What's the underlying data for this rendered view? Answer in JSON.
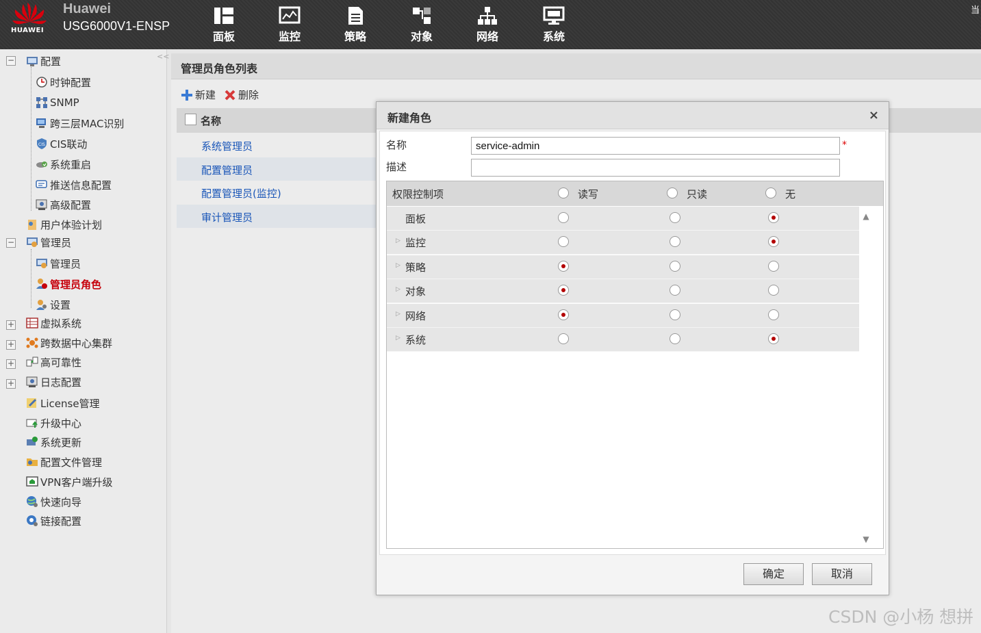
{
  "header": {
    "brand": "Huawei",
    "model": "USG6000V1-ENSP",
    "logo_text": "HUAWEI",
    "corner_glyph": "当",
    "nav": [
      {
        "label": "面板",
        "icon": "dashboard-icon"
      },
      {
        "label": "监控",
        "icon": "monitor-icon"
      },
      {
        "label": "策略",
        "icon": "policy-icon"
      },
      {
        "label": "对象",
        "icon": "object-icon"
      },
      {
        "label": "网络",
        "icon": "network-icon"
      },
      {
        "label": "系统",
        "icon": "system-icon"
      }
    ]
  },
  "sidebar": {
    "collapse_glyph": "<<",
    "items": [
      {
        "label": "配置",
        "toggle": "−"
      },
      {
        "label": "时钟配置"
      },
      {
        "label": "SNMP"
      },
      {
        "label": "跨三层MAC识别"
      },
      {
        "label": "CIS联动"
      },
      {
        "label": "系统重启"
      },
      {
        "label": "推送信息配置"
      },
      {
        "label": "高级配置"
      },
      {
        "label": "用户体验计划"
      },
      {
        "label": "管理员",
        "toggle": "−"
      },
      {
        "label": "管理员"
      },
      {
        "label": "管理员角色",
        "active": true
      },
      {
        "label": "设置"
      },
      {
        "label": "虚拟系统",
        "toggle": "+"
      },
      {
        "label": "跨数据中心集群",
        "toggle": "+"
      },
      {
        "label": "高可靠性",
        "toggle": "+"
      },
      {
        "label": "日志配置",
        "toggle": "+"
      },
      {
        "label": "License管理"
      },
      {
        "label": "升级中心"
      },
      {
        "label": "系统更新"
      },
      {
        "label": "配置文件管理"
      },
      {
        "label": "VPN客户端升级"
      },
      {
        "label": "快速向导"
      },
      {
        "label": "链接配置"
      }
    ]
  },
  "main": {
    "title": "管理员角色列表",
    "toolbar": {
      "new_label": "新建",
      "delete_label": "删除"
    },
    "list_header": "名称",
    "rows": [
      "系统管理员",
      "配置管理员",
      "配置管理员(监控)",
      "审计管理员"
    ]
  },
  "dialog": {
    "title": "新建角色",
    "close_glyph": "×",
    "name_label": "名称",
    "name_value": "service-admin",
    "required_mark": "*",
    "desc_label": "描述",
    "desc_value": "",
    "perm": {
      "header_label": "权限控制项",
      "columns": [
        "读写",
        "只读",
        "无"
      ],
      "rows": [
        {
          "label": "面板",
          "expandable": false,
          "selected": "无"
        },
        {
          "label": "监控",
          "expandable": true,
          "selected": "无"
        },
        {
          "label": "策略",
          "expandable": true,
          "selected": "读写"
        },
        {
          "label": "对象",
          "expandable": true,
          "selected": "读写"
        },
        {
          "label": "网络",
          "expandable": true,
          "selected": "读写"
        },
        {
          "label": "系统",
          "expandable": true,
          "selected": "无"
        }
      ]
    },
    "ok_label": "确定",
    "cancel_label": "取消"
  },
  "watermark": "CSDN @小杨 想拼",
  "colors": {
    "accent_red": "#c6000b",
    "link_blue": "#1a56b8",
    "radio_on": "#b30000"
  }
}
